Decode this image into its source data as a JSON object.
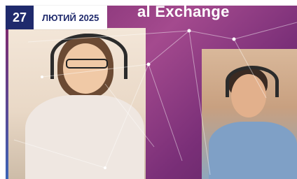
{
  "date": {
    "day": "27",
    "month_year": "ЛЮТИЙ 2025"
  },
  "banner": {
    "title_fragment": "al Exchange"
  },
  "icons": [
    "network-lines-decoration",
    "headphones-icon",
    "headset-icon"
  ]
}
